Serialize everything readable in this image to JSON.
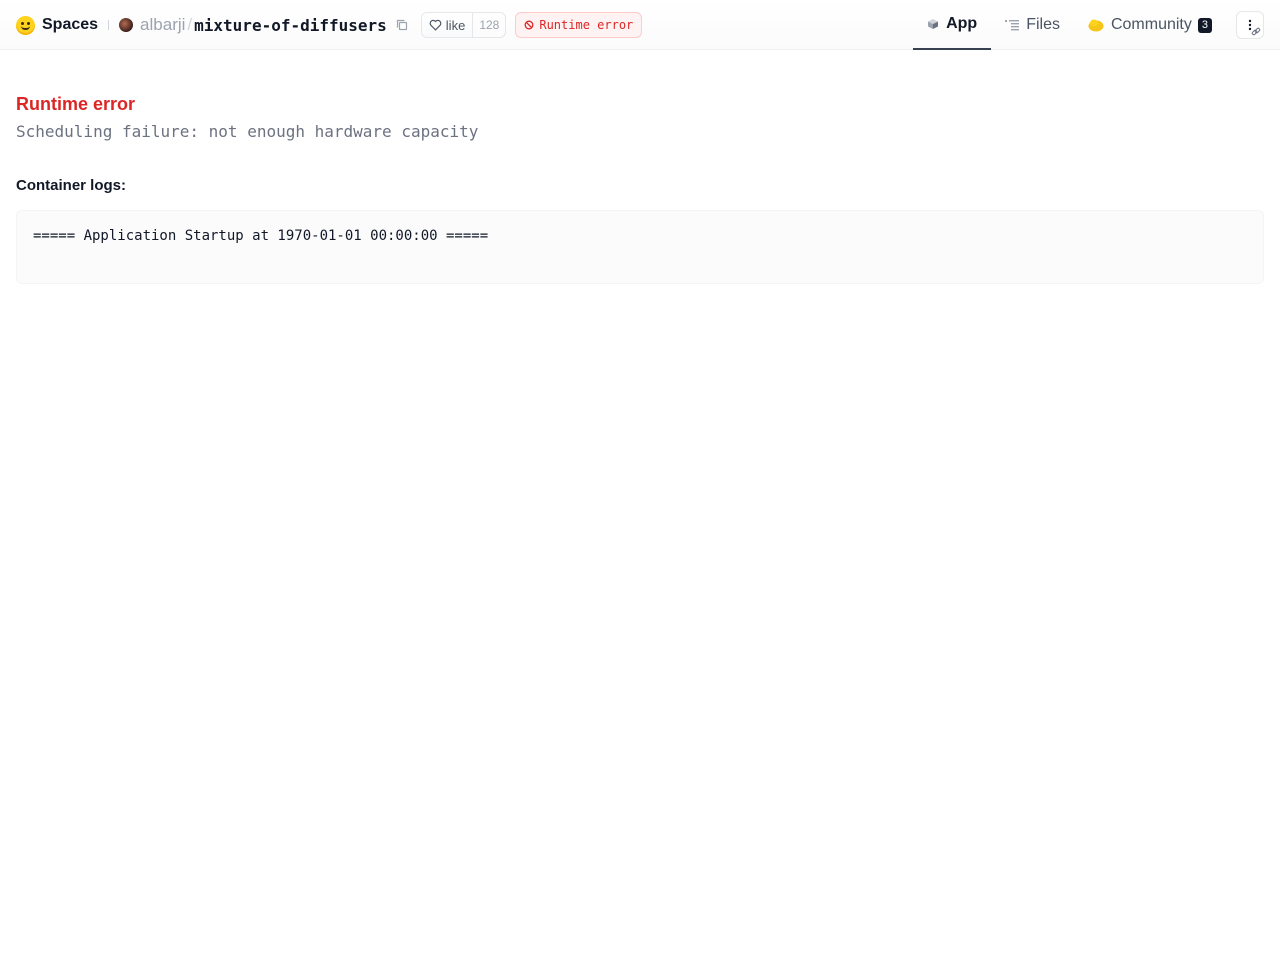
{
  "header": {
    "brand_label": "Spaces",
    "owner": "albarji",
    "separator": "/",
    "repo_name": "mixture-of-diffusers",
    "like_label": "like",
    "like_count": "128",
    "status_label": "Runtime error",
    "tabs": [
      {
        "label": "App",
        "icon": "cube-icon",
        "active": true
      },
      {
        "label": "Files",
        "icon": "files-icon",
        "active": false
      },
      {
        "label": "Community",
        "icon": "community-icon",
        "active": false,
        "badge": "3"
      }
    ]
  },
  "main": {
    "error_title": "Runtime error",
    "error_message": "Scheduling failure: not enough hardware capacity",
    "logs_label": "Container logs:",
    "logs_text": "===== Application Startup at 1970-01-01 00:00:00 ====="
  },
  "colors": {
    "error": "#dc2626",
    "badge_bg": "#fef2f2",
    "brand_yellow": "#ffd21e",
    "tab_underline": "#374151"
  }
}
